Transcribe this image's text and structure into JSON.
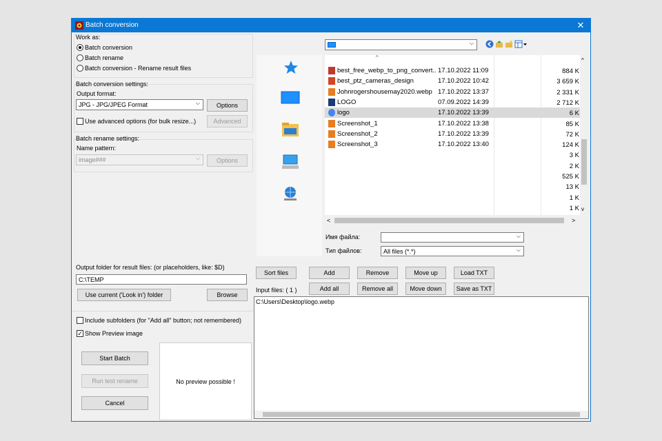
{
  "window": {
    "title": "Batch conversion",
    "close_label": "✕"
  },
  "work_as": {
    "label": "Work as:",
    "options": [
      "Batch conversion",
      "Batch rename",
      "Batch conversion - Rename result files"
    ],
    "selected": 0
  },
  "conversion_settings": {
    "label": "Batch conversion settings:",
    "output_format_label": "Output format:",
    "output_format_value": "JPG - JPG/JPEG Format",
    "options_button": "Options",
    "advanced_checkbox": "Use advanced options (for bulk resize...)",
    "advanced_button": "Advanced"
  },
  "rename_settings": {
    "label": "Batch rename settings:",
    "name_pattern_label": "Name pattern:",
    "name_pattern_value": "image###",
    "options_button": "Options"
  },
  "output_folder": {
    "label": "Output folder for result files: (or placeholders, like: $D)",
    "value": "C:\\TEMP",
    "use_current_button": "Use current ('Look in') folder",
    "browse_button": "Browse"
  },
  "checkboxes": {
    "include_subfolders": "Include subfolders (for \"Add all\" button; not remembered)",
    "show_preview": "Show Preview image",
    "show_preview_check": "✓"
  },
  "actions": {
    "start_batch": "Start Batch",
    "run_test_rename": "Run test rename",
    "cancel": "Cancel"
  },
  "preview": {
    "text": "No preview possible !"
  },
  "files": [
    {
      "name": "best_free_webp_to_png_convert...",
      "date": "17.10.2022 11:09",
      "icon": "image-icon",
      "color": "#c0392b"
    },
    {
      "name": "best_ptz_cameras_design",
      "date": "17.10.2022 10:42",
      "icon": "pdf-icon",
      "color": "#d24726"
    },
    {
      "name": "Johnrogershousemay2020.webp",
      "date": "17.10.2022 13:37",
      "icon": "image-icon",
      "color": "#e67e22"
    },
    {
      "name": "LOGO",
      "date": "07.09.2022 14:39",
      "icon": "app-icon",
      "color": "#1a3a7a"
    },
    {
      "name": "logo",
      "date": "17.10.2022 13:39",
      "icon": "chrome-icon",
      "color": "#4285f4"
    },
    {
      "name": "Screenshot_1",
      "date": "17.10.2022 13:38",
      "icon": "image-icon",
      "color": "#e67e22"
    },
    {
      "name": "Screenshot_2",
      "date": "17.10.2022 13:39",
      "icon": "image-icon",
      "color": "#e67e22"
    },
    {
      "name": "Screenshot_3",
      "date": "17.10.2022 13:40",
      "icon": "image-icon",
      "color": "#e67e22"
    }
  ],
  "sizes": [
    "884 K",
    "3 659 K",
    "2 331 K",
    "2 712 K",
    "6 K",
    "85 K",
    "72 K",
    "124 K",
    "3 K",
    "2 K",
    "525 K",
    "13 K",
    "1 K",
    "1 K"
  ],
  "selected_file_index": 4,
  "file_dialog": {
    "filename_label": "Имя файла:",
    "filename_value": "",
    "filetype_label": "Тип файлов:",
    "filetype_value": "All files (*.*)"
  },
  "list_buttons": {
    "sort_files": "Sort files",
    "add": "Add",
    "remove": "Remove",
    "move_up": "Move up",
    "load_txt": "Load TXT",
    "add_all": "Add all",
    "remove_all": "Remove all",
    "move_down": "Move down",
    "save_as_txt": "Save as TXT"
  },
  "input_files": {
    "label": "Input files:  ( 1 )",
    "items": [
      "C:\\Users\\Desktop\\logo.webp"
    ]
  },
  "colors": {
    "accent": "#0a78d4",
    "selected_row": "#d9d9d9"
  }
}
